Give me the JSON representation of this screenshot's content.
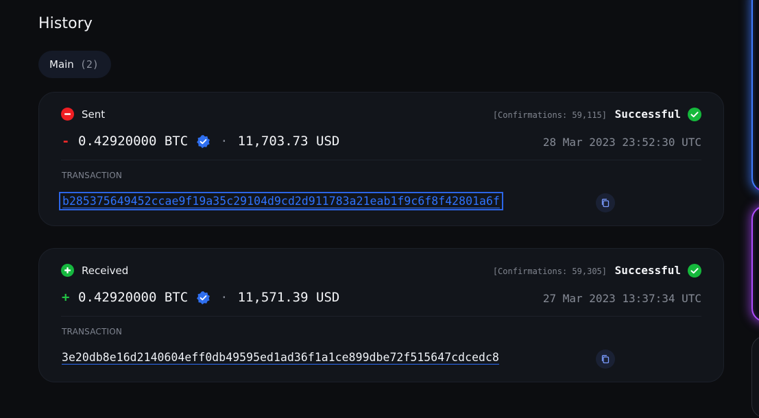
{
  "title": "History",
  "tab": {
    "label": "Main",
    "count": "(2)"
  },
  "transaction_label": "TRANSACTION",
  "transactions": [
    {
      "direction": "Sent",
      "sign": "-",
      "confirmations": "[Confirmations: 59,115]",
      "status": "Successful",
      "amount": "0.42920000 BTC",
      "separator": "·",
      "usd": "11,703.73 USD",
      "date": "28 Mar 2023 23:52:30 UTC",
      "hash": "b285375649452ccae9f19a35c29104d9cd2d911783a21eab1f9c6f8f42801a6f"
    },
    {
      "direction": "Received",
      "sign": "+",
      "confirmations": "[Confirmations: 59,305]",
      "status": "Successful",
      "amount": "0.42920000 BTC",
      "separator": "·",
      "usd": "11,571.39 USD",
      "date": "27 Mar 2023 13:37:34 UTC",
      "hash": "3e20db8e16d2140604eff0db49595ed1ad36f1a1ce899dbe72f515647cdcedc8"
    }
  ],
  "colors": {
    "sent": "#ef1e23",
    "received": "#16b83f",
    "accent": "#2d6cf6",
    "success": "#15b93c"
  },
  "icons": [
    "minus-circle-icon",
    "plus-circle-icon",
    "check-circle-icon",
    "verified-badge-icon",
    "copy-icon"
  ]
}
